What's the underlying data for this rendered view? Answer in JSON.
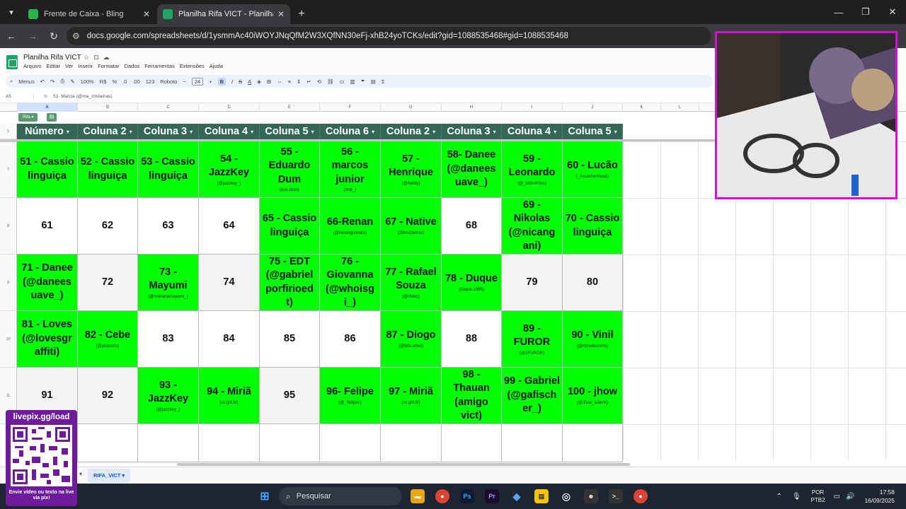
{
  "browser": {
    "tabs": [
      {
        "title": "Frente de Caixa - Bling",
        "active": false,
        "color": "#2bb24c"
      },
      {
        "title": "Planilha Rifa VICT - Planilhas Go",
        "active": true,
        "color": "#1fa463"
      }
    ],
    "url": "docs.google.com/spreadsheets/d/1ysmmAc40iWOYJNqQfM2W3XQfNN30eFj-xhB24yoTCKs/edit?gid=1088535468#gid=1088535468"
  },
  "sheets": {
    "title": "Planilha Rifa VICT",
    "menus": [
      "Arquivo",
      "Editar",
      "Ver",
      "Inserir",
      "Formatar",
      "Dados",
      "Ferramentas",
      "Extensões",
      "Ajuda"
    ],
    "toolbar": {
      "search": "Menus",
      "zoom": "100%",
      "font": "Roboto",
      "font_size": "24",
      "currency": "R$",
      "percent": "%",
      "numfmt": "123"
    },
    "name_box": "A5",
    "formula": "51- Marcia (@ma_cristainas)",
    "columns": [
      "A",
      "B",
      "C",
      "D",
      "E",
      "F",
      "G",
      "H",
      "I",
      "J",
      "K",
      "L"
    ],
    "filter_tag": "Rifa",
    "row_numbers": [
      "1",
      "7",
      "8",
      "9",
      "10",
      "11"
    ],
    "headers": [
      "Número",
      "Coluna 2",
      "Coluna 3",
      "Coluna 4",
      "Coluna 5",
      "Coluna 6",
      "Coluna 2",
      "Coluna 3",
      "Coluna 4",
      "Coluna 5"
    ],
    "rows": [
      [
        {
          "t": "51 - Cassio linguiça",
          "h": "",
          "c": "g"
        },
        {
          "t": "52 - Cassio linguiça",
          "h": "",
          "c": "g"
        },
        {
          "t": "53 - Cassio linguiça",
          "h": "",
          "c": "g"
        },
        {
          "t": "54 - JazzKey",
          "h": "(@jazzkey_)",
          "c": "g"
        },
        {
          "t": "55 - Eduardo Dum",
          "h": "(edu.dum)",
          "c": "g"
        },
        {
          "t": "56 - marcos junior",
          "h": "(mrjr_)",
          "c": "g"
        },
        {
          "t": "57 - Henrique",
          "h": "(@hakity)",
          "c": "g"
        },
        {
          "t": "58- Danee (@danees uave_)",
          "h": "",
          "c": "g"
        },
        {
          "t": "59 - Leonardo",
          "h": "(@_le0m4rtins)",
          "c": "g"
        },
        {
          "t": "60 - Lucão",
          "h": "(_llucashenrique)",
          "c": "g"
        }
      ],
      [
        {
          "t": "61",
          "h": "",
          "c": "w"
        },
        {
          "t": "62",
          "h": "",
          "c": "w"
        },
        {
          "t": "63",
          "h": "",
          "c": "w"
        },
        {
          "t": "64",
          "h": "",
          "c": "w"
        },
        {
          "t": "65 - Cassio linguiça",
          "h": "",
          "c": "g"
        },
        {
          "t": "66-Renan",
          "h": "(@renangnonato)",
          "c": "g"
        },
        {
          "t": "67 - Native",
          "h": "(2litros2letras)",
          "c": "g"
        },
        {
          "t": "68",
          "h": "",
          "c": "w"
        },
        {
          "t": "69 - Nikolas (@nicang ani)",
          "h": "",
          "c": "g"
        },
        {
          "t": "70 - Cassio linguiça",
          "h": "",
          "c": "g"
        }
      ],
      [
        {
          "t": "71 - Danee (@danees uave_)",
          "h": "",
          "c": "g"
        },
        {
          "t": "72",
          "h": "",
          "c": "l"
        },
        {
          "t": "73 - Mayumi",
          "h": "(@marianamayumi_)",
          "c": "g"
        },
        {
          "t": "74",
          "h": "",
          "c": "l"
        },
        {
          "t": "75 - EDT (@gabriel porfirioed t)",
          "h": "",
          "c": "g"
        },
        {
          "t": "76 - Giovanna (@whoisg i_)",
          "h": "",
          "c": "g"
        },
        {
          "t": "77 - Rafael Souza",
          "h": "(@rfldez)",
          "c": "g"
        },
        {
          "t": "78 - Duque",
          "h": "(duque.1985)",
          "c": "g"
        },
        {
          "t": "79",
          "h": "",
          "c": "l"
        },
        {
          "t": "80",
          "h": "",
          "c": "l"
        }
      ],
      [
        {
          "t": "81 - Loves (@lovesgr affiti)",
          "h": "",
          "c": "g"
        },
        {
          "t": "82 - Cebe",
          "h": "(@pcasstro)",
          "c": "g"
        },
        {
          "t": "83",
          "h": "",
          "c": "w"
        },
        {
          "t": "84",
          "h": "",
          "c": "w"
        },
        {
          "t": "85",
          "h": "",
          "c": "w"
        },
        {
          "t": "86",
          "h": "",
          "c": "w"
        },
        {
          "t": "87 - Diogo",
          "h": "(@dds.artes)",
          "c": "g"
        },
        {
          "t": "88",
          "h": "",
          "c": "w"
        },
        {
          "t": "89 - FUROR",
          "h": "(@1FUROR)",
          "c": "g"
        },
        {
          "t": "90 - Vinil",
          "h": "(@ritmodocorre)",
          "c": "g"
        }
      ],
      [
        {
          "t": "91",
          "h": "",
          "c": "l"
        },
        {
          "t": "92",
          "h": "",
          "c": "l"
        },
        {
          "t": "93 - JazzKey",
          "h": "(@jazzkey_)",
          "c": "g"
        },
        {
          "t": "94 - Miriã",
          "h": "(sc.girl.bf)",
          "c": "g"
        },
        {
          "t": "95",
          "h": "",
          "c": "l"
        },
        {
          "t": "96- Felipe",
          "h": "(@_ffelipec)",
          "c": "g"
        },
        {
          "t": "97 - Miriã",
          "h": "(sc.girl.bf)",
          "c": "g"
        },
        {
          "t": "98 - Thauan (amigo vict)",
          "h": "",
          "c": "g"
        },
        {
          "t": "99 - Gabriel (@gafisch er_)",
          "h": "",
          "c": "g"
        },
        {
          "t": "100 - jhow",
          "h": "(@Jhoe_asterik)",
          "c": "g"
        }
      ]
    ],
    "sheet_tab": "RIFA_VICT"
  },
  "overlay": {
    "qr_title": "livepix.gg/load",
    "qr_footer": "Envie vídeo ou texto na live via pix!"
  },
  "taskbar": {
    "search": "Pesquisar",
    "lang1": "POR",
    "lang2": "PTB2",
    "time": "17:58",
    "date": "16/09/2025"
  },
  "colors": {
    "green": "#00ff00",
    "header": "#356854",
    "webcam_border": "#d60fd6",
    "qr_bg": "#6d1a9c"
  }
}
